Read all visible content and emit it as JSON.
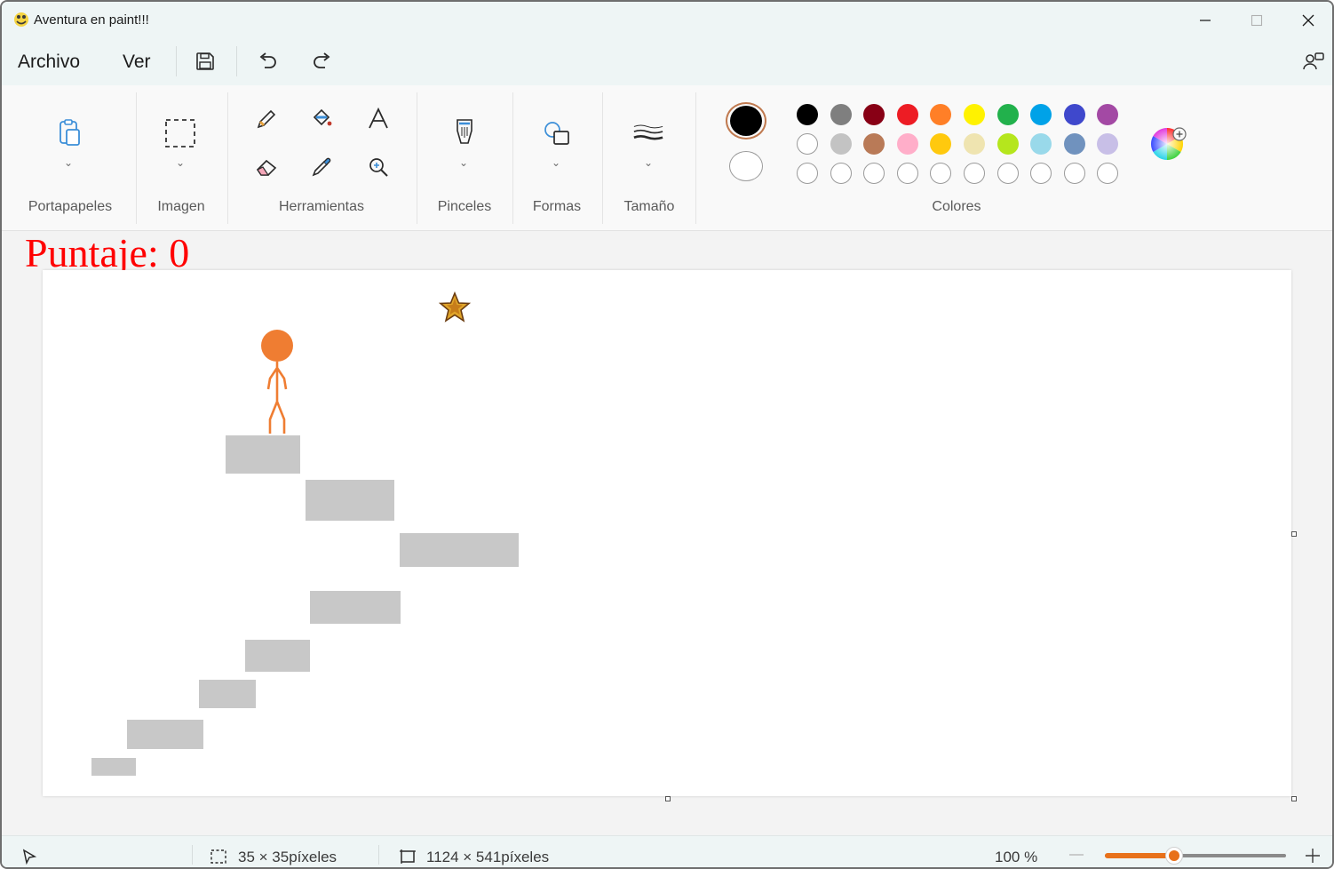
{
  "window": {
    "title": "Aventura en paint!!!",
    "app_icon": "python-snake-icon",
    "controls": [
      "minimize-icon",
      "maximize-icon",
      "close-icon"
    ]
  },
  "menubar": {
    "archivo": "Archivo",
    "ver": "Ver",
    "icons": [
      "save-icon",
      "undo-icon",
      "redo-icon",
      "share-icon"
    ]
  },
  "ribbon": {
    "groups": {
      "portapapeles": "Portapapeles",
      "imagen": "Imagen",
      "herramientas": "Herramientas",
      "pinceles": "Pinceles",
      "formas": "Formas",
      "tamano": "Tamaño",
      "colores": "Colores"
    },
    "tools": [
      "pencil-icon",
      "fill-bucket-icon",
      "text-icon",
      "eraser-icon",
      "color-picker-icon",
      "magnifier-icon"
    ],
    "primary_color": "#000000",
    "secondary_color": "#ffffff",
    "palette_row1": [
      "#000000",
      "#7f7f7f",
      "#880015",
      "#ed1c24",
      "#ff7f27",
      "#fff200",
      "#22b14c",
      "#00a2e8",
      "#3f48cc",
      "#a349a4"
    ],
    "palette_row2": [
      "#ffffff",
      "#c3c3c3",
      "#b97a57",
      "#ffaec9",
      "#ffc90e",
      "#efe4b0",
      "#b5e61d",
      "#99d9ea",
      "#7092be",
      "#c8bfe7"
    ],
    "palette_row3_count": 10
  },
  "game": {
    "score_text": "Puntaje: 0",
    "score_color": "#ff0000",
    "player_color": "#ef7d32",
    "platform_color": "#c8c8c8",
    "star_icon": "star-icon"
  },
  "statusbar": {
    "selection_size": "35 × 35píxeles",
    "canvas_size": "1124 × 541píxeles",
    "zoom": "100 %",
    "zoom_level_percent": 100,
    "accent": "#e8711a"
  }
}
